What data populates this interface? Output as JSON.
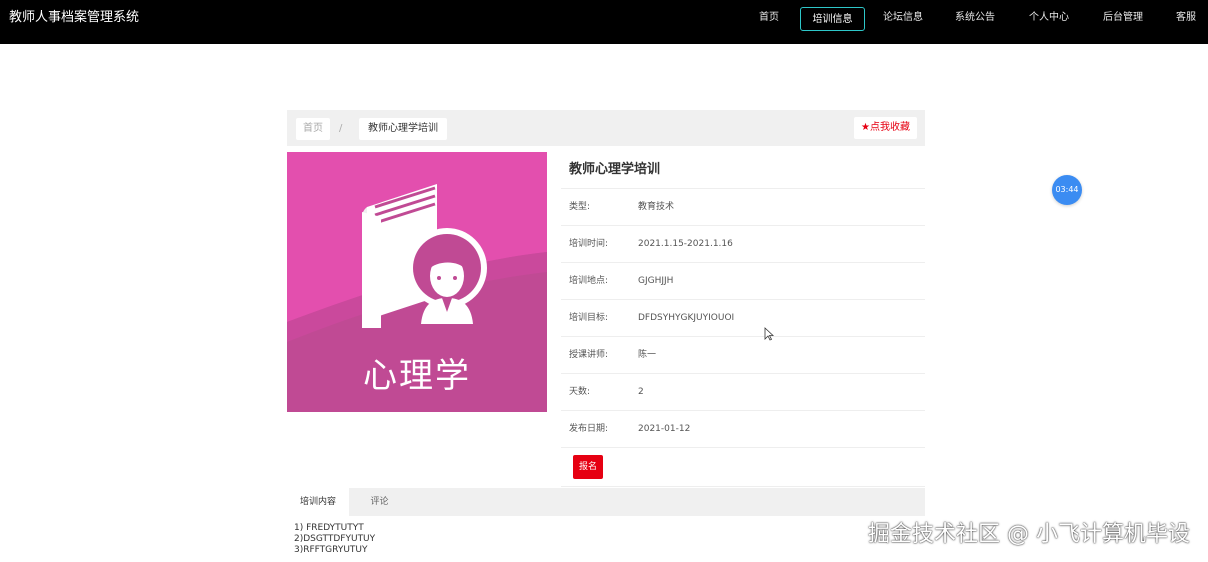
{
  "app": {
    "title": "教师人事档案管理系统"
  },
  "nav": {
    "items": [
      {
        "label": "首页"
      },
      {
        "label": "培训信息"
      },
      {
        "label": "论坛信息"
      },
      {
        "label": "系统公告"
      },
      {
        "label": "个人中心"
      },
      {
        "label": "后台管理"
      },
      {
        "label": "客服"
      }
    ],
    "active_index": 1
  },
  "breadcrumb": {
    "home": "首页",
    "separator": "/",
    "current": "教师心理学培训"
  },
  "favorite": {
    "icon": "star-icon",
    "label": "点我收藏",
    "color": "#e60012"
  },
  "cover": {
    "text": "心理学",
    "background": "#c04a94"
  },
  "detail": {
    "title": "教师心理学培训",
    "rows": [
      {
        "key": "类型:",
        "value": "教育技术"
      },
      {
        "key": "培训时间:",
        "value": "2021.1.15-2021.1.16"
      },
      {
        "key": "培训地点:",
        "value": "GJGHJJH"
      },
      {
        "key": "培训目标:",
        "value": "DFDSYHYGKJUYIOUOI"
      },
      {
        "key": "授课讲师:",
        "value": "陈一"
      },
      {
        "key": "天数:",
        "value": "2"
      },
      {
        "key": "发布日期:",
        "value": "2021-01-12"
      }
    ],
    "enroll_label": "报名"
  },
  "tabs": {
    "items": [
      {
        "label": "培训内容"
      },
      {
        "label": "评论"
      }
    ],
    "active_index": 0,
    "content_lines": [
      "1)  FREDYTUTYT",
      "2)DSGTTDFYUTUY",
      "3)RFFTGRYUTUY"
    ]
  },
  "timer": {
    "text": "03:44"
  },
  "watermark": {
    "text": "掘金技术社区 @ 小飞计算机毕设"
  }
}
